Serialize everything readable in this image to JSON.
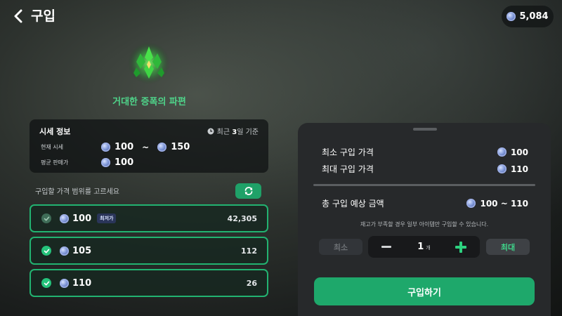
{
  "header": {
    "title": "구입",
    "currency_amount": "5,084"
  },
  "item": {
    "name": "거대한 증폭의 파편"
  },
  "market": {
    "title": "시세 정보",
    "basis_prefix": "최근 ",
    "basis_days": "3",
    "basis_suffix": "일 기준",
    "current_label": "현재 시세",
    "current_low": "100",
    "current_sep": "~",
    "current_high": "150",
    "avg_label": "평균 판매가",
    "avg_value": "100"
  },
  "price_select": {
    "hint": "구입할 가격 범위를 고르세요",
    "options": [
      {
        "price": "100",
        "badge": "최저가",
        "quantity": "42,305",
        "checked": false
      },
      {
        "price": "105",
        "quantity": "112",
        "checked": true
      },
      {
        "price": "110",
        "quantity": "26",
        "checked": true
      }
    ]
  },
  "summary": {
    "min_label": "최소 구입 가격",
    "min_value": "100",
    "max_label": "최대 구입 가격",
    "max_value": "110",
    "total_label": "총 구입 예상 금액",
    "total_value": "100 ~ 110",
    "notice": "재고가 부족할 경우 일부 아이템만 구입할 수 있습니다."
  },
  "quantity": {
    "min_label": "최소",
    "value": "1",
    "unit": "개",
    "max_label": "최대"
  },
  "buy_button": "구입하기",
  "colors": {
    "accent": "#1ea86b",
    "item_name": "#4fd48a",
    "border": "#22b371"
  }
}
